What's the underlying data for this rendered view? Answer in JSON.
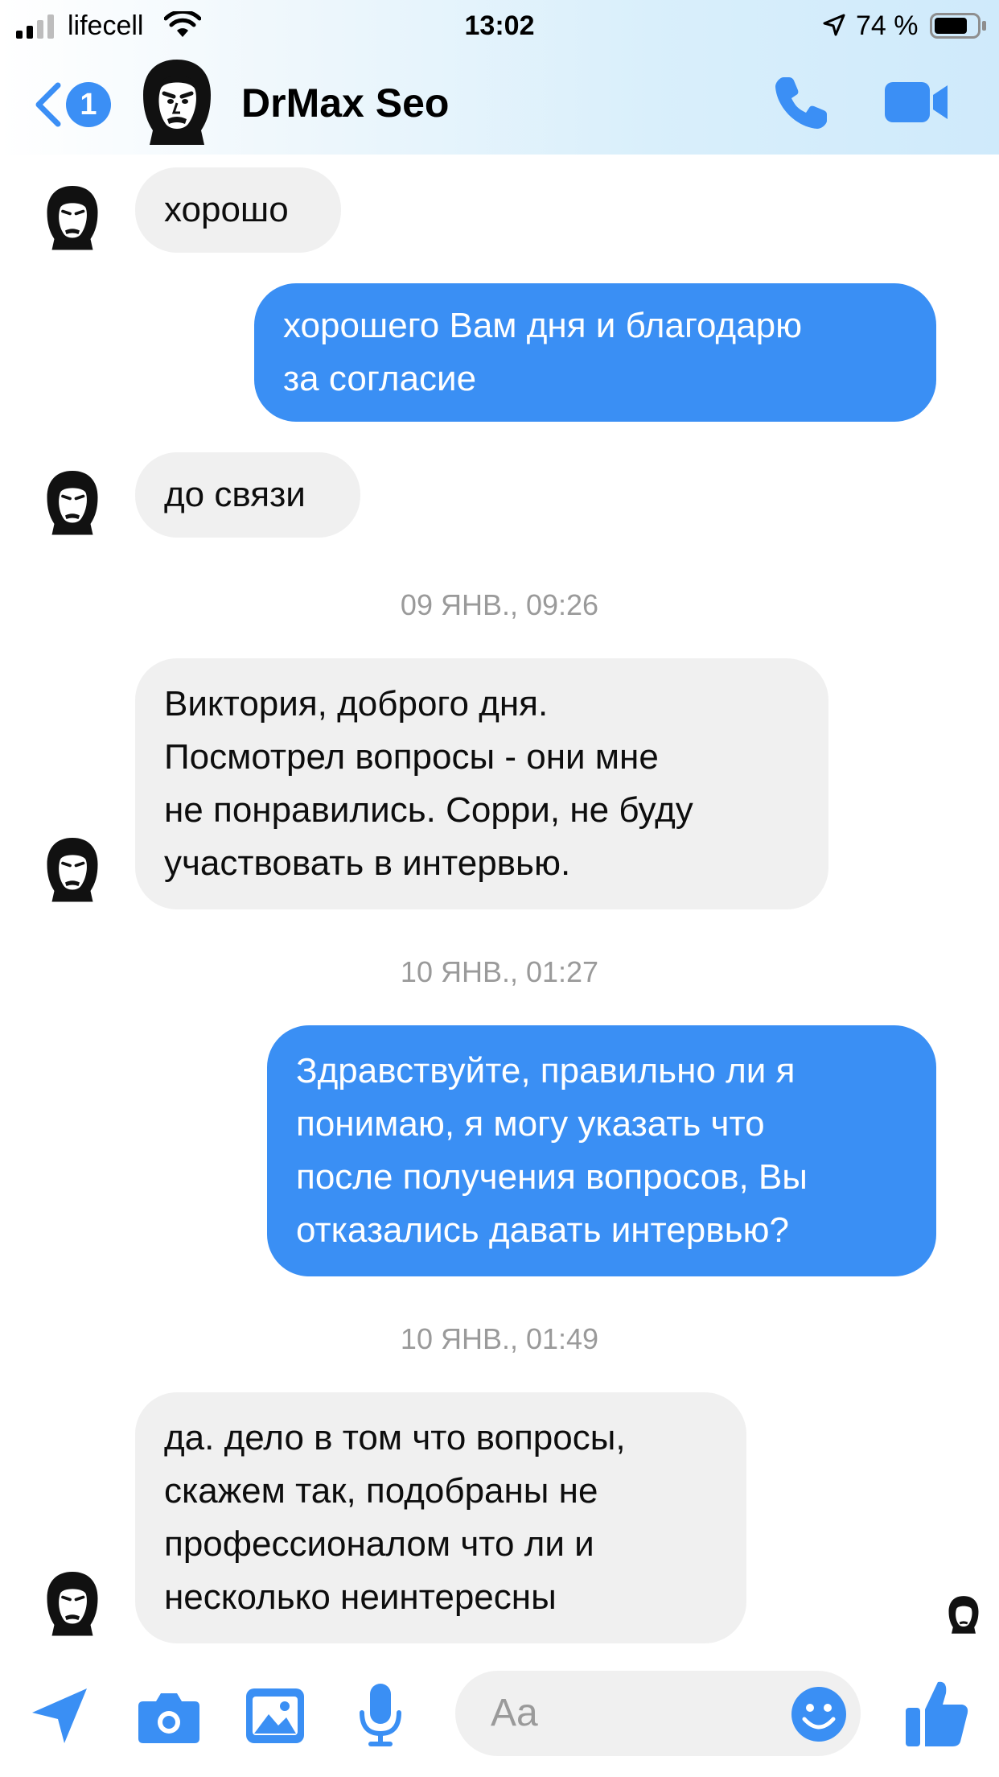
{
  "status_bar": {
    "carrier": "lifecell",
    "time": "13:02",
    "battery": "74 %",
    "icons": [
      "signal-icon",
      "wifi-icon",
      "location-arrow-icon",
      "battery-icon"
    ]
  },
  "header": {
    "back_badge": "1",
    "contact_name": "DrMax Seo",
    "icons": [
      "back-chevron-icon",
      "phone-icon",
      "video-camera-icon"
    ]
  },
  "messages": [
    {
      "dir": "in",
      "lines": [
        "хорошо"
      ]
    },
    {
      "dir": "out",
      "lines": [
        "хорошего Вам дня и благодарю",
        "за согласие"
      ]
    },
    {
      "dir": "in",
      "lines": [
        "до связи"
      ]
    },
    {
      "dir": "in",
      "lines": [
        "Виктория, доброго дня.",
        "Посмотрел вопросы - они мне",
        "не понравились. Сорри, не буду",
        "участвовать в интервью."
      ]
    },
    {
      "dir": "out",
      "lines": [
        "Здравствуйте, правильно ли я",
        "понимаю, я могу указать что",
        "после получения вопросов, Вы",
        "отказались давать интервью?"
      ]
    },
    {
      "dir": "in",
      "lines": [
        "да. дело в том что вопросы,",
        "скажем так, подобраны не",
        "профессионалом что ли и",
        "несколько неинтересны"
      ]
    }
  ],
  "timestamps": [
    "09 ЯНВ., 09:26",
    "10 ЯНВ., 01:27",
    "10 ЯНВ., 01:49"
  ],
  "composer": {
    "placeholder": "Aa",
    "icons": [
      "send-arrow-icon",
      "camera-icon",
      "gallery-icon",
      "microphone-icon",
      "emoji-icon",
      "thumbs-up-icon"
    ]
  },
  "colors": {
    "accent": "#3a8ff4",
    "incoming_bubble": "#f0f0f0",
    "timestamp": "#9a9a9a"
  }
}
